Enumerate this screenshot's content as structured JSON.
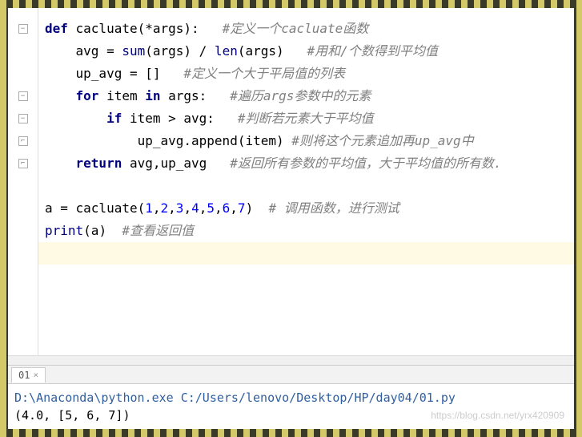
{
  "code": {
    "lines": [
      {
        "indent": 0,
        "segments": [
          {
            "cls": "kw",
            "t": "def "
          },
          {
            "cls": "fn",
            "t": "cacluate(*args):   "
          },
          {
            "cls": "comment",
            "t": "#定义一个cacluate函数"
          }
        ]
      },
      {
        "indent": 1,
        "segments": [
          {
            "cls": "fn",
            "t": "avg = "
          },
          {
            "cls": "builtin",
            "t": "sum"
          },
          {
            "cls": "fn",
            "t": "(args) / "
          },
          {
            "cls": "builtin",
            "t": "len"
          },
          {
            "cls": "fn",
            "t": "(args)   "
          },
          {
            "cls": "comment",
            "t": "#用和/个数得到平均值"
          }
        ]
      },
      {
        "indent": 1,
        "segments": [
          {
            "cls": "fn",
            "t": "up_avg = []   "
          },
          {
            "cls": "comment",
            "t": "#定义一个大于平局值的列表"
          }
        ]
      },
      {
        "indent": 1,
        "segments": [
          {
            "cls": "kw",
            "t": "for "
          },
          {
            "cls": "fn",
            "t": "item "
          },
          {
            "cls": "kw",
            "t": "in "
          },
          {
            "cls": "fn",
            "t": "args:   "
          },
          {
            "cls": "comment",
            "t": "#遍历args参数中的元素"
          }
        ]
      },
      {
        "indent": 2,
        "segments": [
          {
            "cls": "kw",
            "t": "if "
          },
          {
            "cls": "fn",
            "t": "item > avg:   "
          },
          {
            "cls": "comment",
            "t": "#判断若元素大于平均值"
          }
        ]
      },
      {
        "indent": 3,
        "segments": [
          {
            "cls": "fn",
            "t": "up_avg.append(item) "
          },
          {
            "cls": "comment",
            "t": "#则将这个元素追加再up_avg中"
          }
        ]
      },
      {
        "indent": 1,
        "segments": [
          {
            "cls": "kw",
            "t": "return "
          },
          {
            "cls": "fn",
            "t": "avg,up_avg   "
          },
          {
            "cls": "comment",
            "t": "#返回所有参数的平均值，大于平均值的所有数."
          }
        ]
      },
      {
        "indent": 0,
        "segments": []
      },
      {
        "indent": 0,
        "segments": [
          {
            "cls": "fn",
            "t": "a = cacluate("
          },
          {
            "cls": "num",
            "t": "1"
          },
          {
            "cls": "op",
            "t": ","
          },
          {
            "cls": "num",
            "t": "2"
          },
          {
            "cls": "op",
            "t": ","
          },
          {
            "cls": "num",
            "t": "3"
          },
          {
            "cls": "op",
            "t": ","
          },
          {
            "cls": "num",
            "t": "4"
          },
          {
            "cls": "op",
            "t": ","
          },
          {
            "cls": "num",
            "t": "5"
          },
          {
            "cls": "op",
            "t": ","
          },
          {
            "cls": "num",
            "t": "6"
          },
          {
            "cls": "op",
            "t": ","
          },
          {
            "cls": "num",
            "t": "7"
          },
          {
            "cls": "fn",
            "t": ")  "
          },
          {
            "cls": "comment",
            "t": "# 调用函数，进行测试"
          }
        ]
      },
      {
        "indent": 0,
        "segments": [
          {
            "cls": "builtin",
            "t": "print"
          },
          {
            "cls": "fn",
            "t": "(a)  "
          },
          {
            "cls": "comment",
            "t": "#查看返回值"
          }
        ]
      }
    ],
    "gutter_folds": [
      0,
      3,
      4,
      5,
      6
    ]
  },
  "tab": {
    "label": "01",
    "close": "×"
  },
  "console": {
    "path": "D:\\Anaconda\\python.exe C:/Users/lenovo/Desktop/HP/day04/01.py",
    "output": "(4.0, [5, 6, 7])"
  },
  "watermark": "https://blog.csdn.net/yrx420909"
}
